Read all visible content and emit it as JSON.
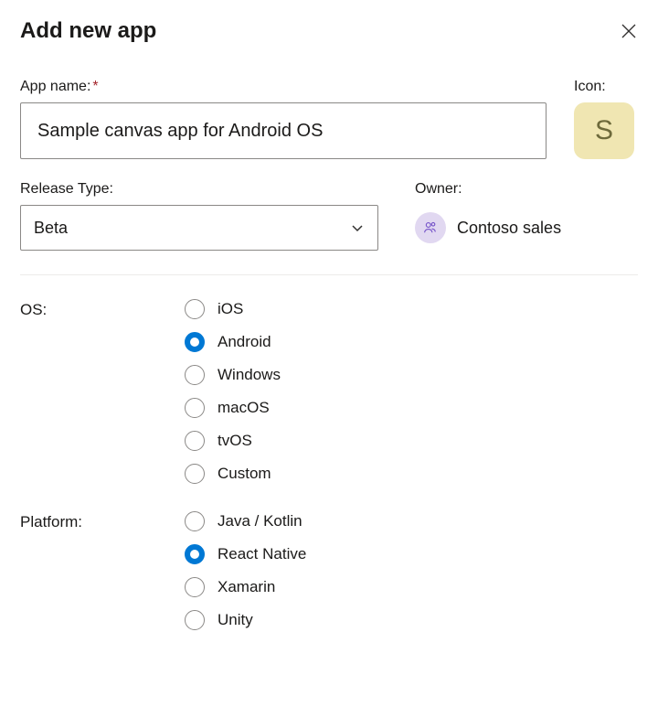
{
  "header": {
    "title": "Add new app"
  },
  "form": {
    "app_name": {
      "label": "App name:",
      "required_mark": "*",
      "value": "Sample canvas app for Android OS"
    },
    "icon": {
      "label": "Icon:",
      "letter": "S"
    },
    "release_type": {
      "label": "Release Type:",
      "value": "Beta"
    },
    "owner": {
      "label": "Owner:",
      "value": "Contoso sales"
    },
    "os": {
      "label": "OS:",
      "options": [
        "iOS",
        "Android",
        "Windows",
        "macOS",
        "tvOS",
        "Custom"
      ],
      "selected": "Android"
    },
    "platform": {
      "label": "Platform:",
      "options": [
        "Java / Kotlin",
        "React Native",
        "Xamarin",
        "Unity"
      ],
      "selected": "React Native"
    }
  }
}
